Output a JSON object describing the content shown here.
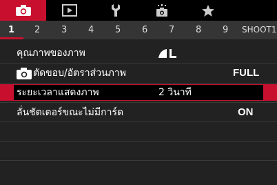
{
  "tabs": [
    {
      "icon": "camera-icon",
      "active": true
    },
    {
      "icon": "playback-icon",
      "active": false
    },
    {
      "icon": "wrench-icon",
      "active": false
    },
    {
      "icon": "wifi-camera-icon",
      "active": false
    },
    {
      "icon": "star-icon",
      "active": false
    }
  ],
  "pages": [
    "1",
    "2",
    "3",
    "4",
    "5",
    "6",
    "7",
    "8",
    "9",
    "SHOOT1"
  ],
  "menu": {
    "items": [
      {
        "label": "คุณภาพของภาพ",
        "value": ""
      },
      {
        "label": "ตัดขอบ/อัตราส่วนภาพ",
        "value": "FULL"
      },
      {
        "label": "ระยะเวลาแสดงภาพ",
        "value": "2 วินาที"
      },
      {
        "label": "ลั่นชัตเตอร์ขณะไม่มีการ์ด",
        "value": "ON"
      }
    ]
  },
  "colors": {
    "accent": "#c8102e",
    "bg": "#222222"
  }
}
